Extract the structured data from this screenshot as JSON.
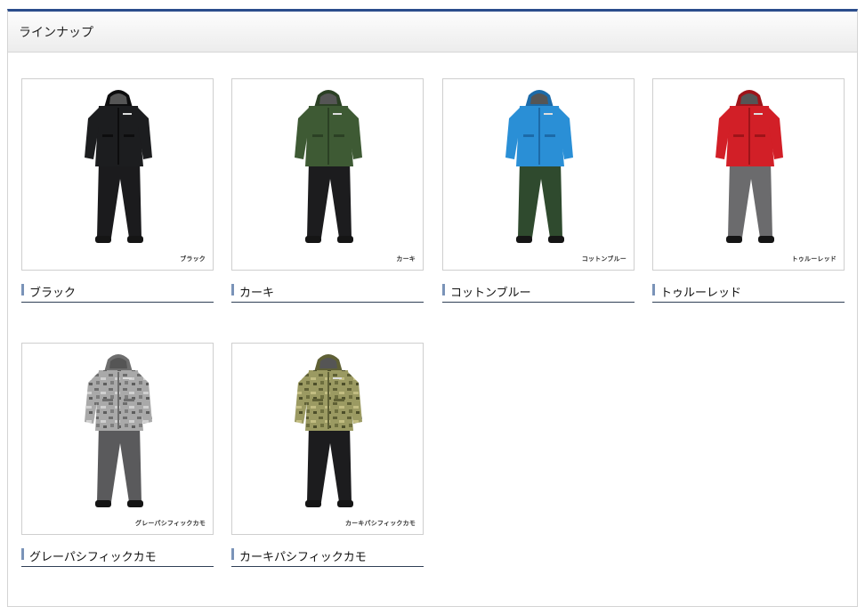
{
  "section": {
    "title": "ラインナップ"
  },
  "colors": {
    "header_rule": "#2b4d8c",
    "caption_marker": "#7a93b8"
  },
  "products": [
    {
      "name": "ブラック",
      "image_label": "ブラック",
      "jacket": "#1c1d1f",
      "jacket_shade": "#0d0d0e",
      "pants": "#1b1b1d",
      "pattern": "none"
    },
    {
      "name": "カーキ",
      "image_label": "カーキ",
      "jacket": "#3e5a34",
      "jacket_shade": "#2b4024",
      "pants": "#1c1c1e",
      "pattern": "none"
    },
    {
      "name": "コットンブルー",
      "image_label": "コットンブルー",
      "jacket": "#2a8fd6",
      "jacket_shade": "#1c6aa8",
      "pants": "#2f4a2e",
      "pattern": "none"
    },
    {
      "name": "トゥルーレッド",
      "image_label": "トゥルーレッド",
      "jacket": "#d21f27",
      "jacket_shade": "#9e1419",
      "pants": "#6b6b6d",
      "pattern": "none"
    },
    {
      "name": "グレーパシフィックカモ",
      "image_label": "グレーパシフィックカモ",
      "jacket": "#9a9a9a",
      "jacket_shade": "#6e6e6e",
      "pants": "#5a5a5c",
      "pattern": "camo-grey"
    },
    {
      "name": "カーキパシフィックカモ",
      "image_label": "カーキパシフィックカモ",
      "jacket": "#8a8a52",
      "jacket_shade": "#5f6035",
      "pants": "#1c1c1e",
      "pattern": "camo-khaki"
    }
  ]
}
